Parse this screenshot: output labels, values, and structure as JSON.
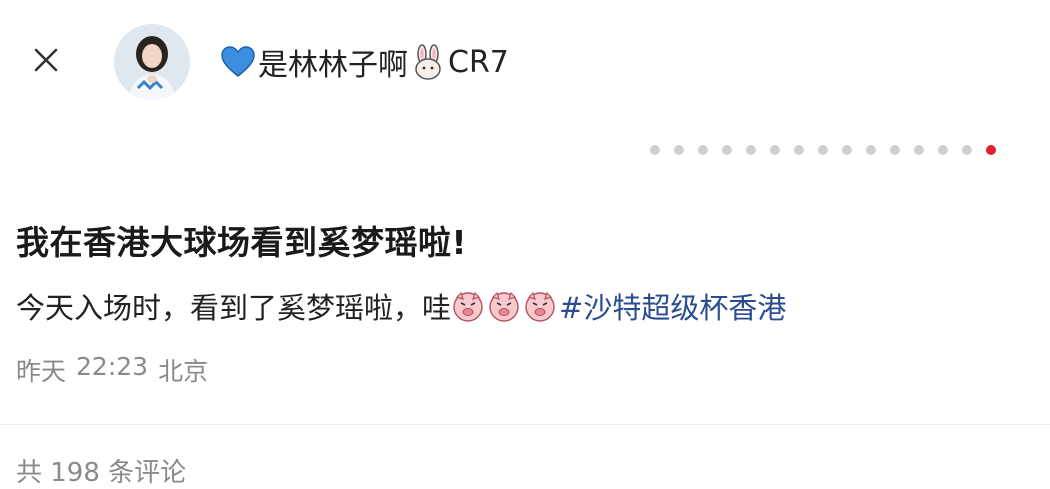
{
  "header": {
    "username_prefix_icon": "blue-heart-icon",
    "username_main": "是林林子啊",
    "username_suffix_icon": "rabbit-icon",
    "username_tail": "CR7"
  },
  "carousel": {
    "total": 15,
    "active_index": 14,
    "active_color": "#e5202e"
  },
  "post": {
    "title": "我在香港大球场看到奚梦瑶啦!",
    "body_text": "今天入场时，看到了奚梦瑶啦，哇",
    "emoji": "pig-face-icon",
    "hashtag": "#沙特超级杯香港"
  },
  "meta": {
    "date": "昨天",
    "time": "22:23",
    "location": "北京"
  },
  "comments": {
    "label": "共 198 条评论"
  }
}
